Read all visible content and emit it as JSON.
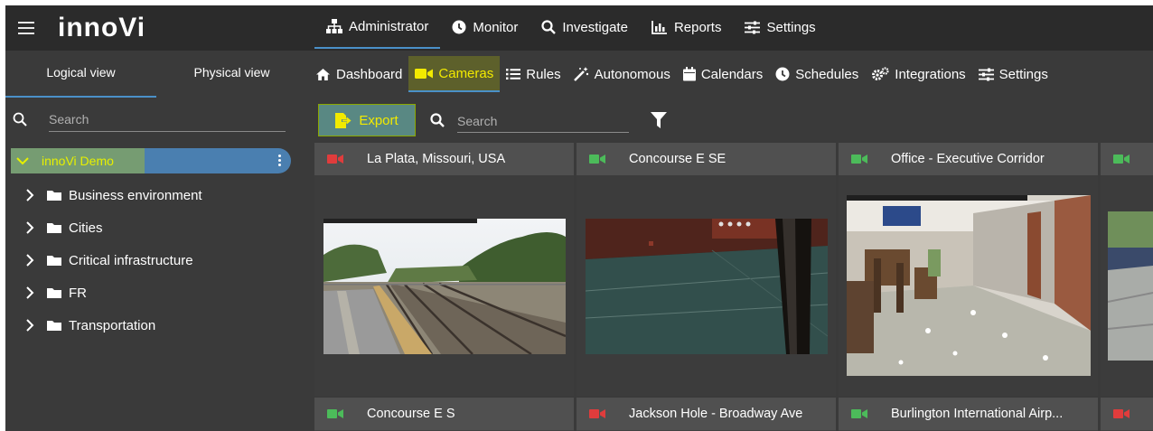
{
  "topnav": {
    "logo": "innoVi",
    "items": [
      {
        "label": "Administrator",
        "icon": "sitemap-icon",
        "active": true
      },
      {
        "label": "Monitor",
        "icon": "clock-icon",
        "active": false
      },
      {
        "label": "Investigate",
        "icon": "search-icon",
        "active": false
      },
      {
        "label": "Reports",
        "icon": "bar-chart-icon",
        "active": false
      },
      {
        "label": "Settings",
        "icon": "sliders-icon",
        "active": false
      }
    ]
  },
  "sidebar": {
    "tabs": [
      {
        "label": "Logical view",
        "active": true
      },
      {
        "label": "Physical view",
        "active": false
      }
    ],
    "search_placeholder": "Search",
    "root": {
      "label": "innoVi Demo"
    },
    "items": [
      {
        "label": "Business environment"
      },
      {
        "label": "Cities"
      },
      {
        "label": "Critical infrastructure"
      },
      {
        "label": "FR"
      },
      {
        "label": "Transportation"
      }
    ]
  },
  "subnav": {
    "items": [
      {
        "label": "Dashboard",
        "icon": "home-icon",
        "active": false
      },
      {
        "label": "Cameras",
        "icon": "video-camera-icon",
        "active": true
      },
      {
        "label": "Rules",
        "icon": "list-icon",
        "active": false
      },
      {
        "label": "Autonomous",
        "icon": "magic-wand-icon",
        "active": false
      },
      {
        "label": "Calendars",
        "icon": "calendar-icon",
        "active": false
      },
      {
        "label": "Schedules",
        "icon": "clock-icon",
        "active": false
      },
      {
        "label": "Integrations",
        "icon": "cogs-icon",
        "active": false
      },
      {
        "label": "Settings",
        "icon": "sliders-icon",
        "active": false
      }
    ]
  },
  "toolbar": {
    "export_label": "Export",
    "search_placeholder": "Search"
  },
  "cameras": [
    {
      "name": "La Plata, Missouri, USA",
      "status": "offline",
      "status_color": "#e03c3c"
    },
    {
      "name": "Concourse E SE",
      "status": "online",
      "status_color": "#4cbb5a"
    },
    {
      "name": "Office - Executive Corridor",
      "status": "online",
      "status_color": "#4cbb5a"
    },
    {
      "name": "",
      "status": "online",
      "status_color": "#4cbb5a"
    },
    {
      "name": "Concourse E S",
      "status": "online",
      "status_color": "#4cbb5a"
    },
    {
      "name": "Jackson Hole - Broadway Ave",
      "status": "offline",
      "status_color": "#e03c3c"
    },
    {
      "name": "Burlington International Airp...",
      "status": "online",
      "status_color": "#4cbb5a"
    },
    {
      "name": "",
      "status": "offline",
      "status_color": "#e03c3c"
    }
  ],
  "colors": {
    "accent_blue": "#4a90c8",
    "highlight_yellow": "#f2ea00",
    "status_online": "#4cbb5a",
    "status_offline": "#e03c3c"
  }
}
